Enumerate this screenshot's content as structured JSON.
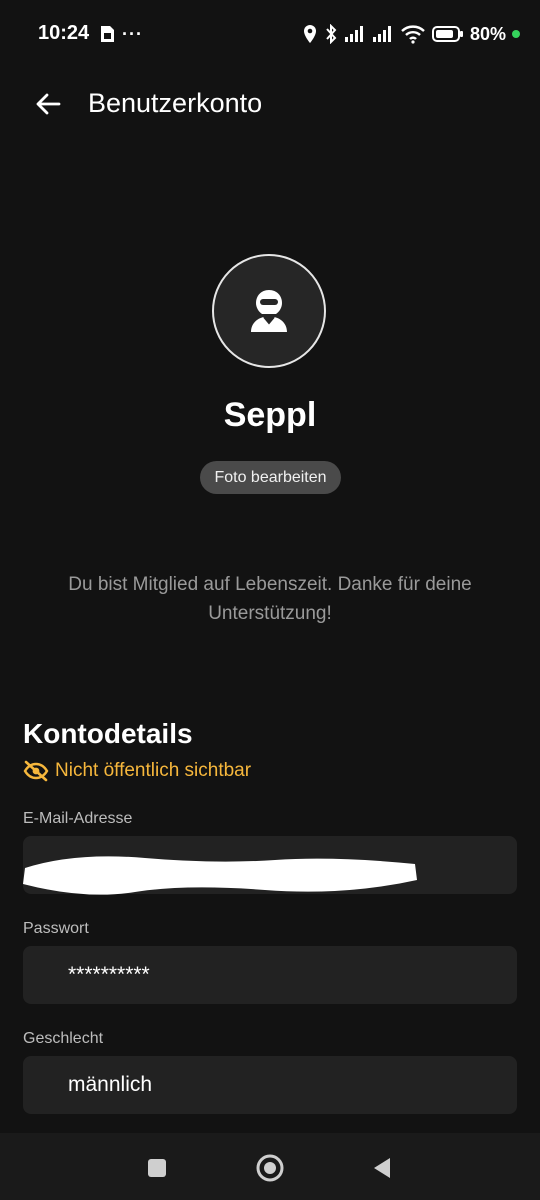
{
  "status_bar": {
    "time": "10:24",
    "notification_more": "···",
    "battery_percent": "80%",
    "icons": [
      "sim-card-icon",
      "location-icon",
      "bluetooth-icon",
      "signal-icon",
      "signal-icon",
      "wifi-icon",
      "battery-icon"
    ],
    "dot_color": "#35d35c"
  },
  "app_bar": {
    "title": "Benutzerkonto",
    "back_icon": "arrow-left-icon"
  },
  "profile": {
    "name": "Seppl",
    "avatar_icon": "helmet-rider-icon",
    "edit_photo_label": "Foto bearbeiten",
    "membership_note": "Du bist Mitglied auf Lebenszeit. Danke für deine Unterstützung!"
  },
  "account_details": {
    "title": "Kontodetails",
    "visibility_icon": "eye-off-icon",
    "visibility_text": "Nicht öffentlich sichtbar",
    "accent_color": "#f6b73c",
    "fields": [
      {
        "label": "E-Mail-Adresse",
        "value": ""
      },
      {
        "label": "Passwort",
        "value": "**********"
      },
      {
        "label": "Geschlecht",
        "value": "männlich"
      }
    ]
  },
  "nav_bar": {
    "icons": [
      "recents-square-icon",
      "home-circle-icon",
      "back-triangle-icon"
    ]
  }
}
